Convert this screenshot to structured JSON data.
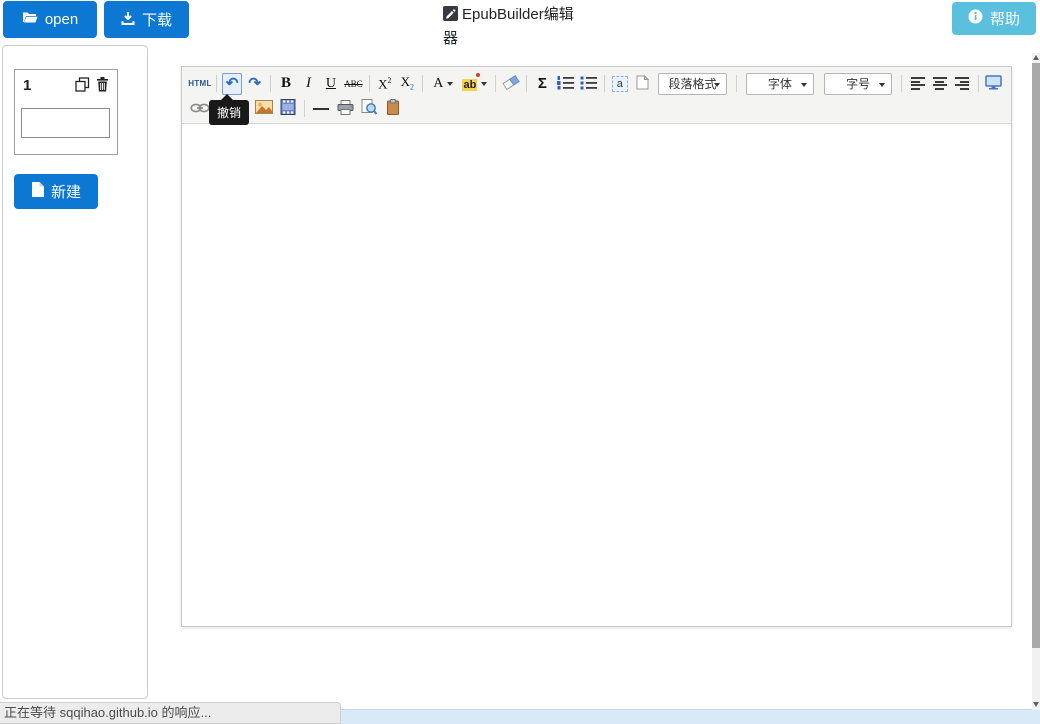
{
  "header": {
    "open_label": "open",
    "download_label": "下载",
    "help_label": "帮助",
    "title": "EpubBuilder编辑器"
  },
  "sidebar": {
    "chapter_number": "1",
    "chapter_title_value": "",
    "new_label": "新建"
  },
  "toolbar": {
    "html": "HTML",
    "undo_glyph": "↶",
    "redo_glyph": "↷",
    "bold": "B",
    "italic": "I",
    "underline": "U",
    "strikethrough": "ABC",
    "sup_base": "X",
    "sup_mark": "2",
    "sub_base": "X",
    "sub_mark": "2",
    "forecolor": "A",
    "highlight": "ab",
    "formula": "Σ",
    "anchor": "a",
    "paragraph_format": "段落格式",
    "font_family": "字体",
    "font_size": "字号"
  },
  "tooltip": {
    "undo": "撤销"
  },
  "editor": {
    "content_value": ""
  },
  "statusbar": {
    "text": "正在等待 sqqihao.github.io 的响应..."
  },
  "colors": {
    "primary_blue": "#0d78d4",
    "info_cyan": "#5bc0de",
    "toolbar_bg": "#f4f4f2",
    "tooltip_bg": "#191919",
    "bottom_band": "#d9e9f7",
    "scroll_thumb": "#a8a8a8"
  }
}
